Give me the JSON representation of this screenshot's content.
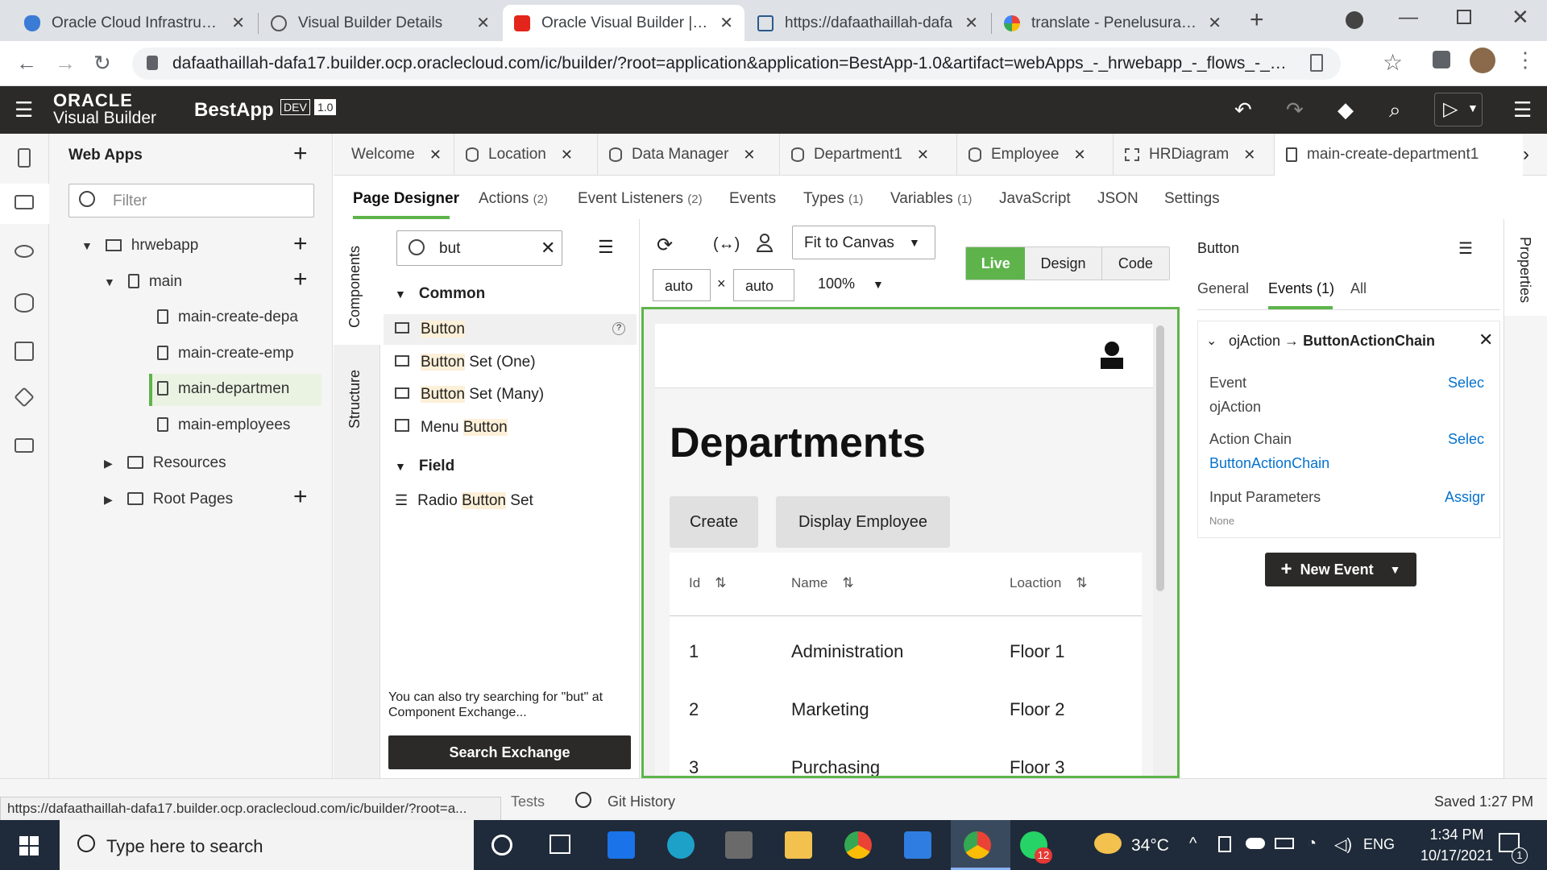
{
  "browser": {
    "tabs": [
      {
        "title": "Oracle Cloud Infrastructur",
        "active": false
      },
      {
        "title": "Visual Builder Details",
        "active": false
      },
      {
        "title": "Oracle Visual Builder | Bes",
        "active": true
      },
      {
        "title": "https://dafaathaillah-dafa",
        "active": false
      },
      {
        "title": "translate - Penelusuran Go",
        "active": false
      }
    ],
    "url": "dafaathaillah-dafa17.builder.ocp.oraclecloud.com/ic/builder/?root=application&application=BestApp-1.0&artifact=webApps_-_hrwebapp_-_flows_-_main_..."
  },
  "header": {
    "brand_line1": "ORACLE",
    "brand_line2": "Visual Builder",
    "app_name": "BestApp",
    "env_badge": "DEV",
    "version_badge": "1.0"
  },
  "webapps": {
    "title": "Web Apps",
    "filter_placeholder": "Filter",
    "tree": {
      "app": "hrwebapp",
      "flow": "main",
      "pages": [
        "main-create-depa",
        "main-create-emp",
        "main-departmen",
        "main-employees"
      ],
      "resources": "Resources",
      "root_pages": "Root Pages"
    }
  },
  "editor_tabs": [
    {
      "label": "Welcome",
      "icon": "none"
    },
    {
      "label": "Location",
      "icon": "database-icon"
    },
    {
      "label": "Data Manager",
      "icon": "database-icon"
    },
    {
      "label": "Department1",
      "icon": "database-icon"
    },
    {
      "label": "Employee",
      "icon": "database-icon"
    },
    {
      "label": "HRDiagram",
      "icon": "diagram-icon"
    },
    {
      "label": "main-create-department1",
      "icon": "file-icon"
    }
  ],
  "sub_tabs": {
    "page_designer": "Page Designer",
    "actions": "Actions",
    "actions_count": "(2)",
    "event_listeners": "Event Listeners",
    "event_listeners_count": "(2)",
    "events": "Events",
    "types": "Types",
    "types_count": "(1)",
    "variables": "Variables",
    "variables_count": "(1)",
    "javascript": "JavaScript",
    "json": "JSON",
    "settings": "Settings"
  },
  "side_tabs": {
    "components": "Components",
    "structure": "Structure",
    "properties": "Properties"
  },
  "components": {
    "search_value": "but",
    "group_common": "Common",
    "group_field": "Field",
    "items": [
      {
        "pre": "",
        "match": "Button",
        "post": ""
      },
      {
        "pre": "",
        "match": "Button",
        "post": " Set (One)"
      },
      {
        "pre": "",
        "match": "Button",
        "post": " Set (Many)"
      },
      {
        "pre": "Menu ",
        "match": "Button",
        "post": ""
      }
    ],
    "field_item": {
      "pre": "Radio ",
      "match": "Button",
      "post": " Set"
    },
    "exchange_hint": "You can also try searching for \"but\" at Component Exchange...",
    "search_exchange": "Search Exchange"
  },
  "canvas_toolbar": {
    "fit": "Fit to Canvas",
    "modes": [
      "Live",
      "Design",
      "Code"
    ],
    "width": "auto",
    "height": "auto",
    "times": "×",
    "zoom": "100%"
  },
  "preview": {
    "heading": "Departments",
    "buttons": [
      "Create",
      "Display Employee"
    ],
    "columns": [
      "Id",
      "Name",
      "Loaction"
    ],
    "rows": [
      [
        "1",
        "Administration",
        "Floor 1"
      ],
      [
        "2",
        "Marketing",
        "Floor 2"
      ],
      [
        "3",
        "Purchasing",
        "Floor 3"
      ]
    ]
  },
  "properties": {
    "title": "Button",
    "tabs": [
      "General",
      "Events (1)",
      "All"
    ],
    "event_header_pre": "ojAction →",
    "event_header_chain": "ButtonActionChain",
    "event_label": "Event",
    "event_link": "Selec",
    "event_value": "ojAction",
    "chain_label": "Action Chain",
    "chain_link": "Selec",
    "chain_value": "ButtonActionChain",
    "params_label": "Input Parameters",
    "params_link": "Assigr",
    "params_value": "None",
    "new_event": "New Event"
  },
  "status": {
    "url": "https://dafaathaillah-dafa17.builder.ocp.oraclecloud.com/ic/builder/?root=a...",
    "tests": "Tests",
    "git_history": "Git History",
    "saved": "Saved 1:27 PM"
  },
  "taskbar": {
    "search_placeholder": "Type here to search",
    "weather": "34°C",
    "lang": "ENG",
    "time": "1:34 PM",
    "date": "10/17/2021",
    "whatsapp_badge": "12",
    "notif_count": "1"
  },
  "colors": {
    "live_green": "#5eb44b",
    "oracle_header": "#2b2a28",
    "link_blue": "#0572ce"
  }
}
